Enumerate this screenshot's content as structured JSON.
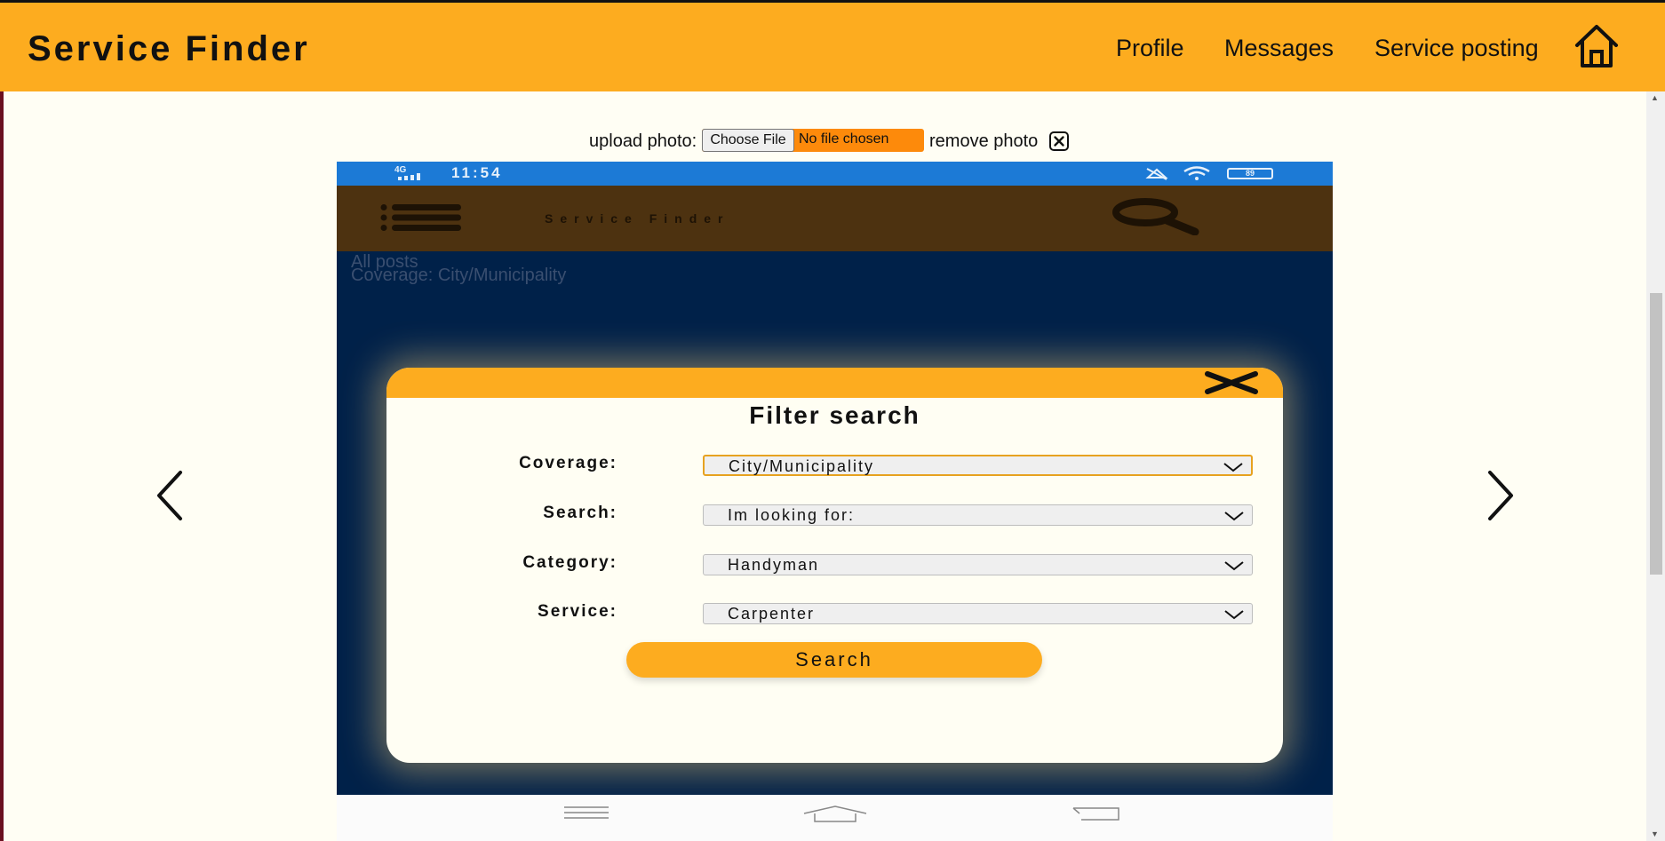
{
  "header": {
    "brand": "Service Finder",
    "nav": {
      "profile": "Profile",
      "messages": "Messages",
      "service_posting": "Service posting"
    },
    "home_icon": "home-icon",
    "accent_color": "#fdac1f"
  },
  "upload": {
    "label": "upload photo:",
    "choose_button": "Choose File",
    "status": "No file chosen",
    "remove_label": "remove photo",
    "remove_icon": "close-square-icon"
  },
  "carousel": {
    "prev_icon": "chevron-left-icon",
    "next_icon": "chevron-right-icon"
  },
  "phone": {
    "status_bar": {
      "signal": "4G",
      "time": "11:54",
      "battery": "89"
    },
    "app_title": "Service Finder",
    "background_lines": [
      "All posts",
      "Coverage: City/Municipality"
    ],
    "filter": {
      "title": "Filter search",
      "fields": [
        {
          "label": "Coverage:",
          "value": "City/Municipality"
        },
        {
          "label": "Search:",
          "value": "Im looking for:"
        },
        {
          "label": "Category:",
          "value": "Handyman"
        },
        {
          "label": "Service:",
          "value": "Carpenter"
        }
      ],
      "search_button": "Search"
    },
    "colors": {
      "status_bar": "#1c7ad6",
      "app_header": "#4d3210",
      "app_body": "#002149"
    }
  }
}
